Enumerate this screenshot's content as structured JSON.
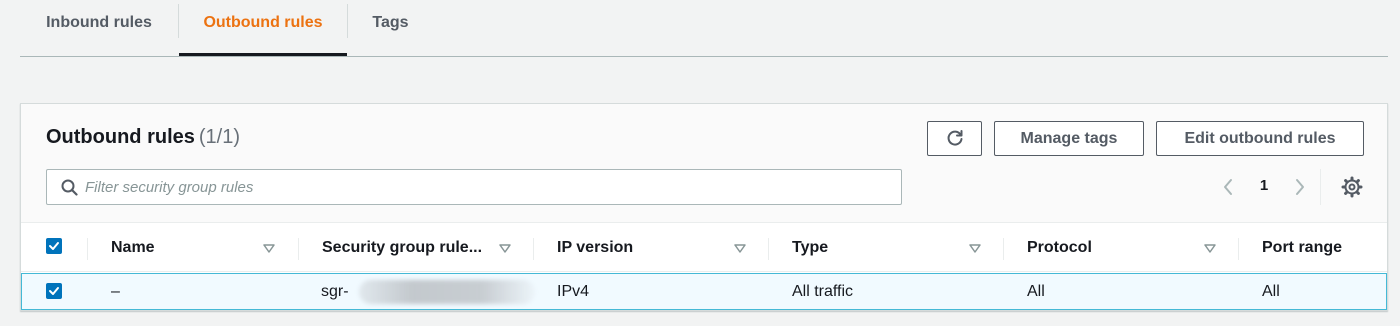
{
  "tabs": [
    {
      "label": "Inbound rules",
      "active": false
    },
    {
      "label": "Outbound rules",
      "active": true
    },
    {
      "label": "Tags",
      "active": false
    }
  ],
  "panel": {
    "title": "Outbound rules",
    "count": "(1/1)",
    "buttons": {
      "refresh_icon": "refresh-icon",
      "manage_tags": "Manage tags",
      "edit_outbound": "Edit outbound rules"
    },
    "search": {
      "placeholder": "Filter security group rules",
      "value": ""
    },
    "pagination": {
      "current_page": "1"
    }
  },
  "table": {
    "columns": [
      "Name",
      "Security group rule...",
      "IP version",
      "Type",
      "Protocol",
      "Port range"
    ],
    "rows": [
      {
        "selected": true,
        "name": "–",
        "rule_id": "sgr-",
        "ip_version": "IPv4",
        "type": "All traffic",
        "protocol": "All",
        "port_range": "All"
      }
    ]
  },
  "colors": {
    "accent": "#ec7211",
    "selection": "#0073bb",
    "row_border": "#44b9d6",
    "row_bg": "#f1faff"
  }
}
